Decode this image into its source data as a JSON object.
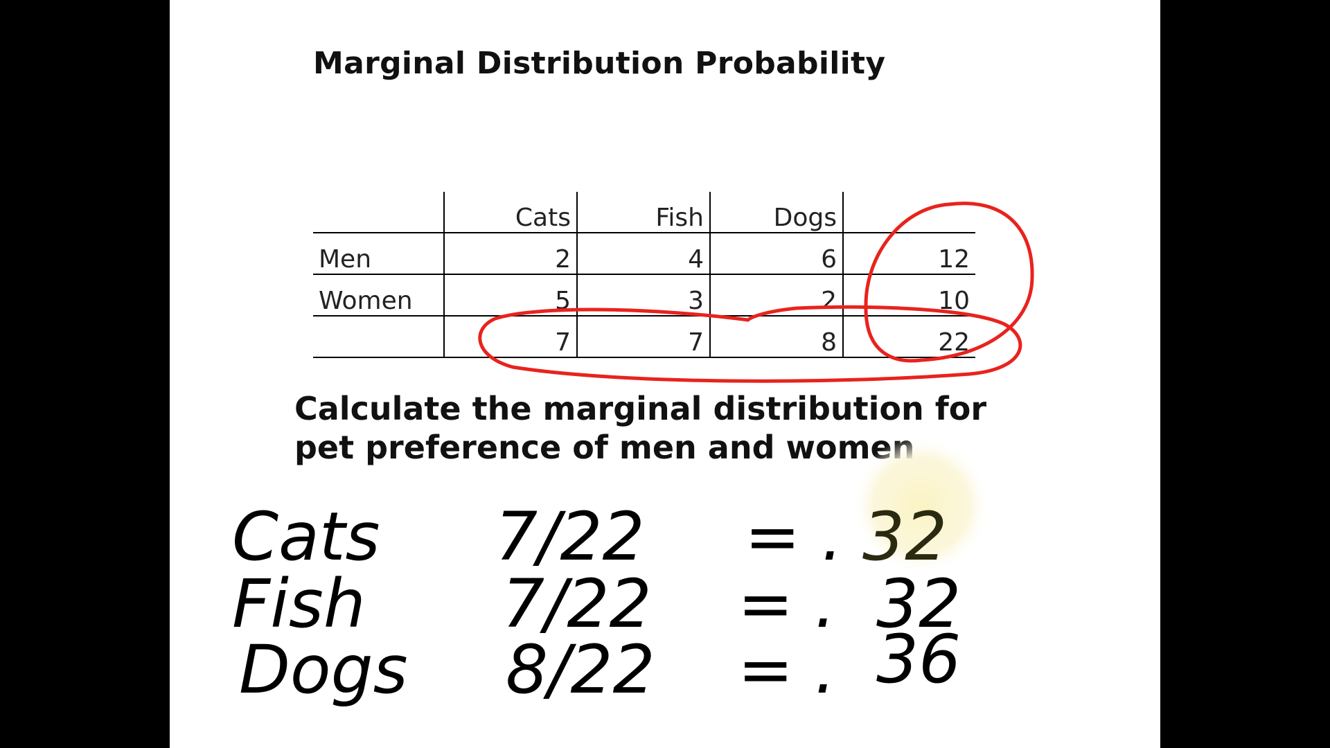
{
  "slide": {
    "title": "Marginal Distribution Probability",
    "prompt": "Calculate the marginal distribution for pet preference of men and women"
  },
  "table": {
    "headers": [
      "",
      "Cats",
      "Fish",
      "Dogs",
      ""
    ],
    "rows": [
      {
        "label": "Men",
        "values": [
          "2",
          "4",
          "6",
          "12"
        ]
      },
      {
        "label": "Women",
        "values": [
          "5",
          "3",
          "2",
          "10"
        ]
      },
      {
        "label": "",
        "values": [
          "7",
          "7",
          "8",
          "22"
        ]
      }
    ]
  },
  "handwriting": {
    "lines": [
      {
        "label": "Cats",
        "fraction": "7/22",
        "equals": "= .",
        "result": "32"
      },
      {
        "label": "Fish",
        "fraction": "7/22",
        "equals": "= .",
        "result": "32"
      },
      {
        "label": "Dogs",
        "fraction": "8/22",
        "equals": "= .",
        "result": "36"
      }
    ]
  },
  "colors": {
    "annotation": "#e8231d",
    "highlight": "#fbf6d2",
    "slide_background": "#ffffff",
    "frame": "#000000"
  }
}
